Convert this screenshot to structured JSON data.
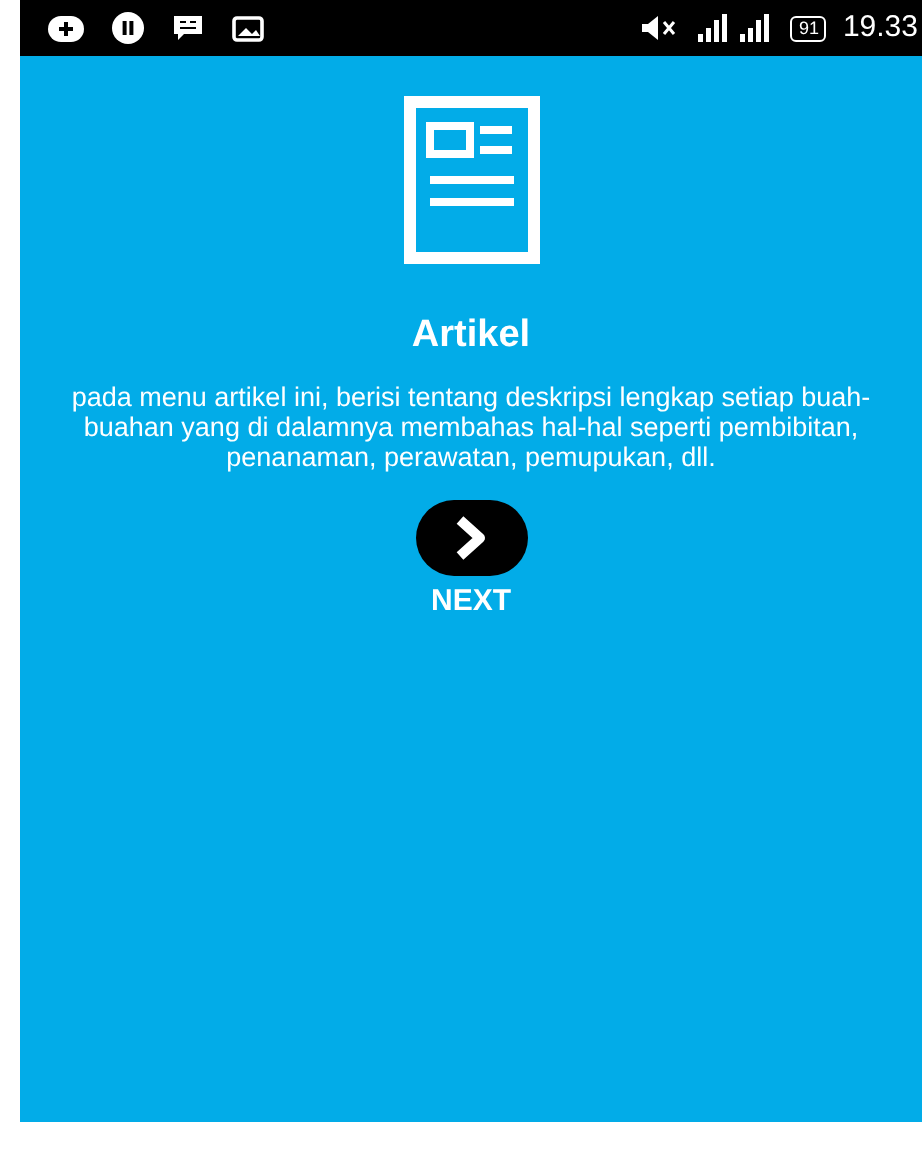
{
  "status_bar": {
    "battery": "91",
    "time": "19.33"
  },
  "intro": {
    "title": "Artikel",
    "description": "pada menu artikel ini, berisi tentang deskripsi lengkap setiap buah-buahan yang di dalamnya membahas hal-hal seperti pembibitan, penanaman, perawatan, pemupukan, dll."
  },
  "next_button": {
    "label": "NEXT"
  }
}
